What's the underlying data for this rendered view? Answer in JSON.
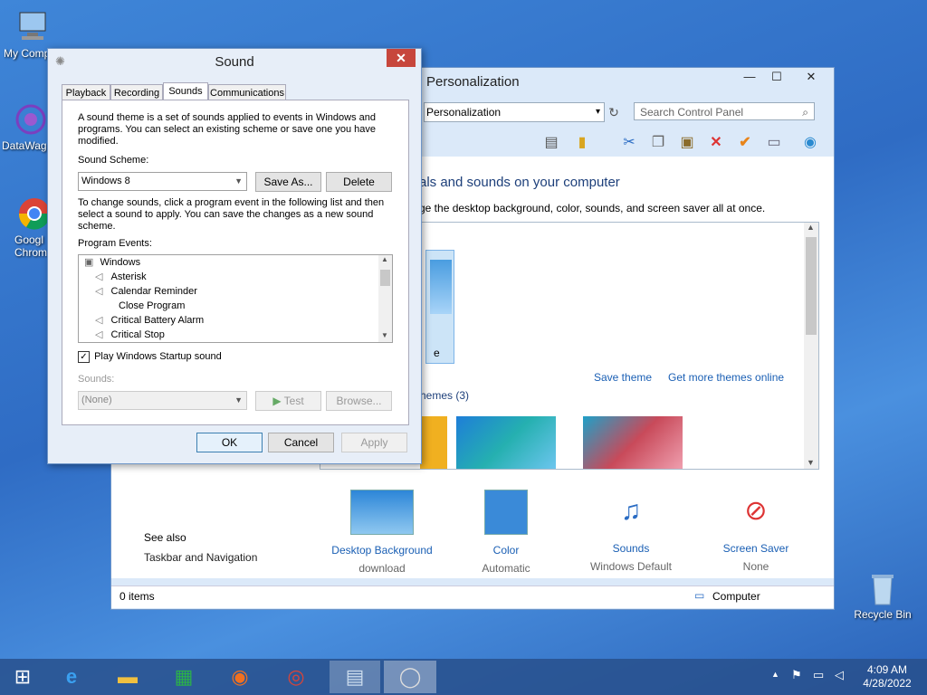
{
  "desktop": {
    "icons": [
      {
        "label": "My Comp"
      },
      {
        "label": "DataWag"
      },
      {
        "label": "Googl\nChrom"
      },
      {
        "label": "Recycle Bin"
      }
    ]
  },
  "personalization": {
    "title": "Personalization",
    "address": "Personalization",
    "search_placeholder": "Search Control Panel",
    "heading": "als and sounds on your computer",
    "subheading": "ge the desktop background, color, sounds, and screen saver all at once.",
    "theme_caption": "e",
    "save_theme": "Save theme",
    "get_more": "Get more themes online",
    "themes_group": "hemes (3)",
    "see_also": "See also",
    "taskbar_nav": "Taskbar and Navigation",
    "bottom_items": [
      {
        "label": "Desktop Background",
        "sub": "download"
      },
      {
        "label": "Color",
        "sub": "Automatic"
      },
      {
        "label": "Sounds",
        "sub": "Windows Default"
      },
      {
        "label": "Screen Saver",
        "sub": "None"
      }
    ],
    "status_items": "0 items",
    "status_location": "Computer"
  },
  "sound_dialog": {
    "title": "Sound",
    "tabs": [
      "Playback",
      "Recording",
      "Sounds",
      "Communications"
    ],
    "description": "A sound theme is a set of sounds applied to events in Windows and programs.  You can select an existing scheme or save one you have modified.",
    "scheme_label": "Sound Scheme:",
    "scheme_value": "Windows 8",
    "save_as": "Save As...",
    "delete": "Delete",
    "instructions": "To change sounds, click a program event in the following list and then select a sound to apply.  You can save the changes as a new sound scheme.",
    "events_label": "Program Events:",
    "events": [
      "Windows",
      "Asterisk",
      "Calendar Reminder",
      "Close Program",
      "Critical Battery Alarm",
      "Critical Stop"
    ],
    "startup_checkbox": "Play Windows Startup sound",
    "startup_checked": true,
    "sounds_label": "Sounds:",
    "sounds_value": "(None)",
    "test": "Test",
    "browse": "Browse...",
    "ok": "OK",
    "cancel": "Cancel",
    "apply": "Apply"
  },
  "taskbar": {
    "time": "4:09 AM",
    "date": "4/28/2022"
  }
}
